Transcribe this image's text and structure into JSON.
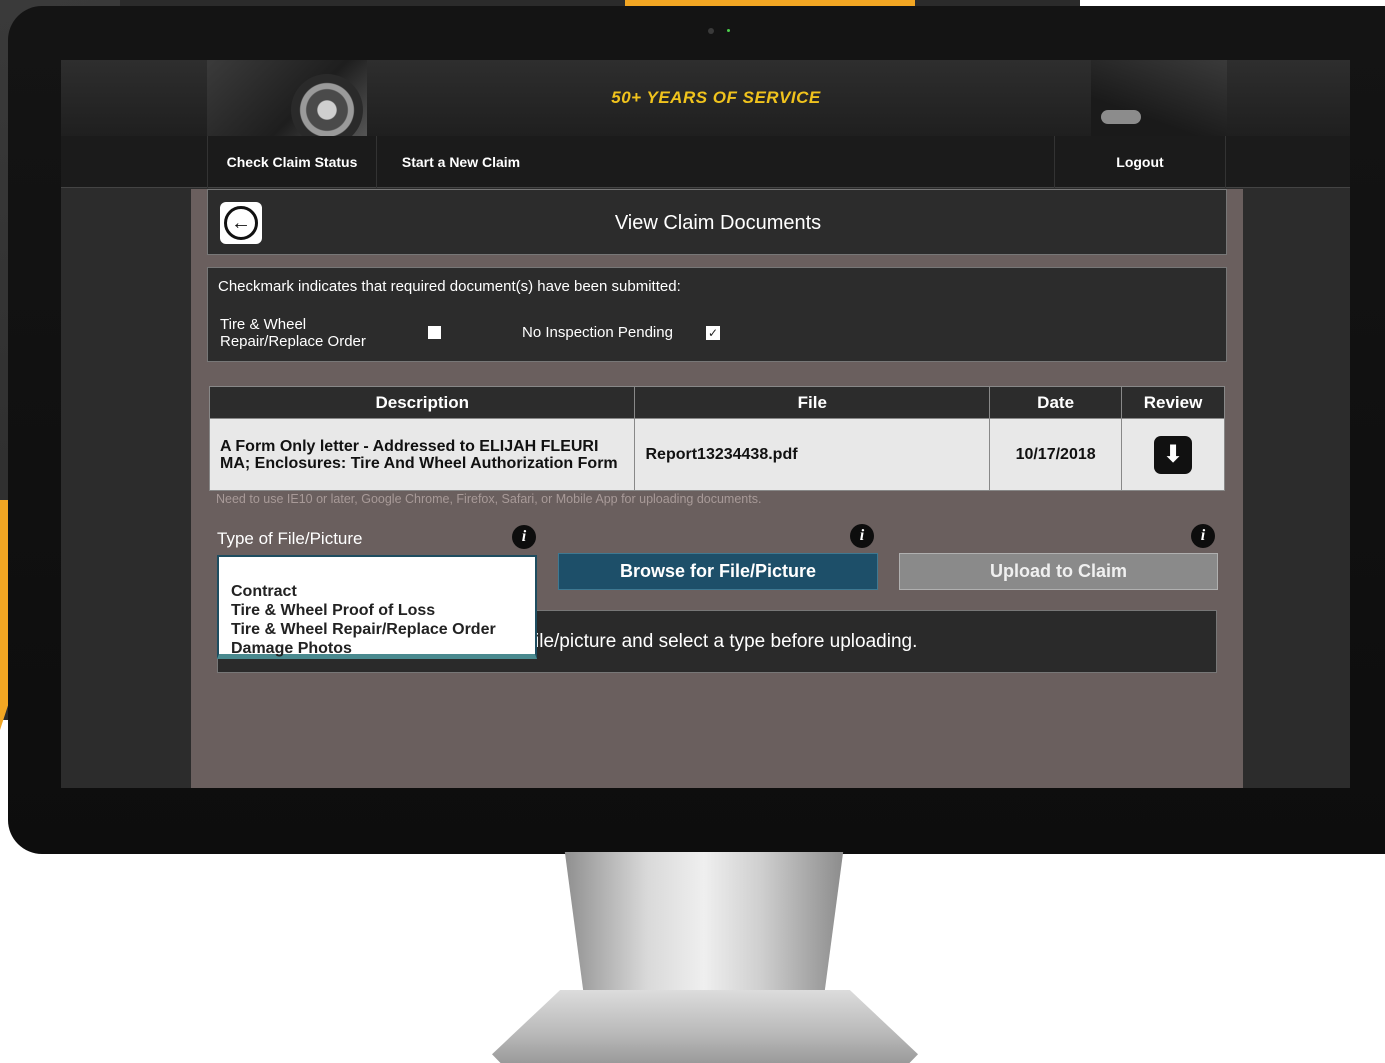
{
  "banner": {
    "title": "50+ YEARS OF SERVICE"
  },
  "nav": {
    "check_status": "Check Claim Status",
    "new_claim": "Start a New Claim",
    "logout": "Logout"
  },
  "page": {
    "title": "View Claim Documents"
  },
  "requirements": {
    "intro": "Checkmark indicates that required document(s) have been submitted:",
    "items": [
      {
        "label_line1": "Tire & Wheel",
        "label_line2": "Repair/Replace Order",
        "checked": false
      },
      {
        "label": "No Inspection Pending",
        "checked": true
      }
    ]
  },
  "documents": {
    "headers": {
      "description": "Description",
      "file": "File",
      "date": "Date",
      "review": "Review"
    },
    "rows": [
      {
        "description": "A Form Only letter - Addressed to ELIJAH FLEURI MA; Enclosures: Tire And Wheel Authorization Form",
        "file": "Report13234438.pdf",
        "date": "10/17/2018"
      }
    ]
  },
  "upload": {
    "browser_note": "Need to use IE10 or later, Google Chrome, Firefox, Safari, or Mobile App for uploading documents.",
    "type_label": "Type of File/Picture",
    "options": [
      "Contract",
      "Tire & Wheel Proof of Loss",
      "Tire & Wheel Repair/Replace Order",
      "Damage Photos"
    ],
    "browse_label": "Browse for File/Picture",
    "upload_label": "Upload to Claim",
    "status_text": "ile/picture and select a type before uploading."
  },
  "icons": {
    "back": "arrow-left-circle-icon",
    "download": "download-icon",
    "info": "info-icon",
    "checkmark": "checkmark-icon"
  },
  "colors": {
    "banner_title": "#f0c31d",
    "content_bg": "#6a5f5e",
    "browse_button": "#1d4f69",
    "upload_button": "#8a8a8a",
    "accent_orange": "#f2a623"
  }
}
